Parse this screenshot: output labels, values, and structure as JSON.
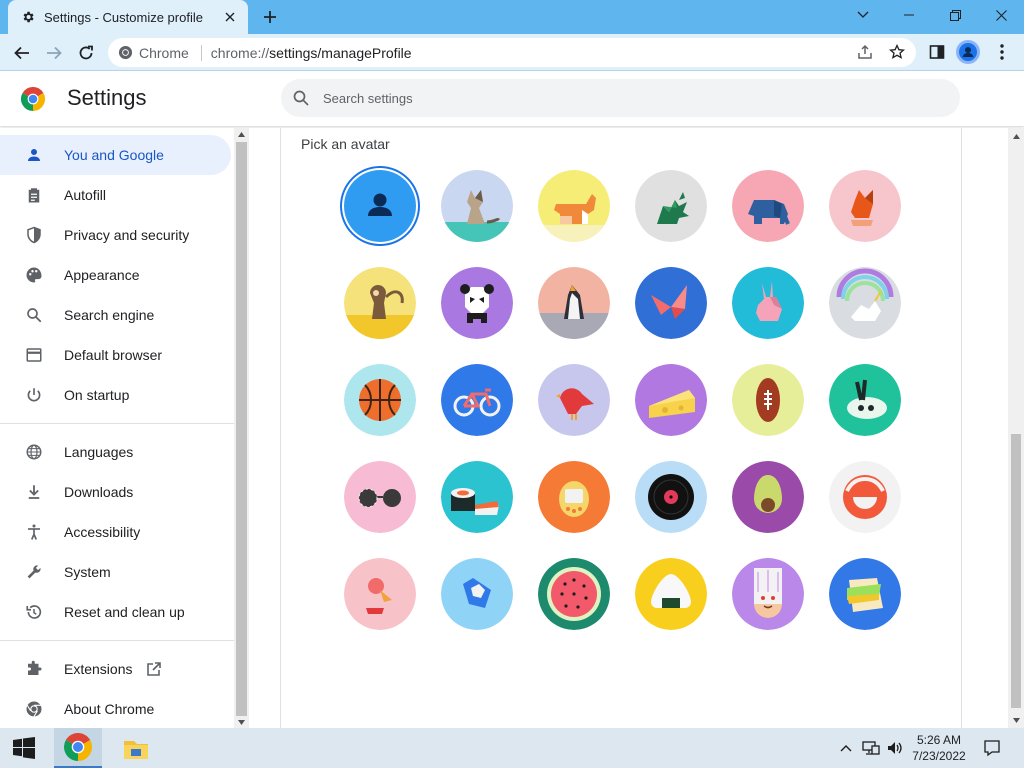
{
  "window": {
    "tab_title": "Settings - Customize profile",
    "url_chip": "Chrome",
    "url_scheme": "chrome://",
    "url_path": "settings/manageProfile"
  },
  "header": {
    "title": "Settings",
    "search_placeholder": "Search settings"
  },
  "sidebar": {
    "items": [
      {
        "label": "You and Google",
        "icon": "person-icon",
        "active": true
      },
      {
        "label": "Autofill",
        "icon": "clipboard-icon"
      },
      {
        "label": "Privacy and security",
        "icon": "shield-icon"
      },
      {
        "label": "Appearance",
        "icon": "palette-icon"
      },
      {
        "label": "Search engine",
        "icon": "search-icon"
      },
      {
        "label": "Default browser",
        "icon": "browser-icon"
      },
      {
        "label": "On startup",
        "icon": "power-icon"
      },
      {
        "label": "Languages",
        "icon": "globe-icon"
      },
      {
        "label": "Downloads",
        "icon": "download-icon"
      },
      {
        "label": "Accessibility",
        "icon": "accessibility-icon"
      },
      {
        "label": "System",
        "icon": "wrench-icon"
      },
      {
        "label": "Reset and clean up",
        "icon": "history-icon"
      },
      {
        "label": "Extensions",
        "icon": "puzzle-icon"
      },
      {
        "label": "About Chrome",
        "icon": "chrome-icon"
      }
    ]
  },
  "main": {
    "heading": "Pick an avatar",
    "avatars": [
      {
        "name": "generic-person",
        "bg": "#2f9cf2",
        "selected": true
      },
      {
        "name": "origami-cat",
        "bg": "#c9d7f0"
      },
      {
        "name": "origami-corgi",
        "bg": "#f5ed76"
      },
      {
        "name": "origami-dragon",
        "bg": "#e0e0e0"
      },
      {
        "name": "origami-elephant",
        "bg": "#f6a7b3"
      },
      {
        "name": "origami-fox",
        "bg": "#f7c6cc"
      },
      {
        "name": "origami-monkey",
        "bg": "#f6e27a"
      },
      {
        "name": "origami-panda",
        "bg": "#a978e0"
      },
      {
        "name": "origami-penguin",
        "bg": "#f3b3a3"
      },
      {
        "name": "origami-butterfly",
        "bg": "#2f6fd6"
      },
      {
        "name": "origami-rabbit",
        "bg": "#22bcd8"
      },
      {
        "name": "origami-unicorn",
        "bg": "#d9dde1"
      },
      {
        "name": "basketball",
        "bg": "#aee6ee"
      },
      {
        "name": "bike",
        "bg": "#2f79e8"
      },
      {
        "name": "red-bird",
        "bg": "#c7c7ee"
      },
      {
        "name": "cheese",
        "bg": "#b078e0"
      },
      {
        "name": "football",
        "bg": "#e7ee9a"
      },
      {
        "name": "sushi-plate",
        "bg": "#1fc29a"
      },
      {
        "name": "sunglasses",
        "bg": "#f7bcd4"
      },
      {
        "name": "sushi",
        "bg": "#2cc3d0"
      },
      {
        "name": "tamagotchi",
        "bg": "#f57a35"
      },
      {
        "name": "vinyl",
        "bg": "#b9dcf7"
      },
      {
        "name": "avocado",
        "bg": "#9a4aa8"
      },
      {
        "name": "cloud-smile",
        "bg": "#f2f2f2"
      },
      {
        "name": "ice-cream",
        "bg": "#f7c3c9"
      },
      {
        "name": "moon",
        "bg": "#8fd3f7"
      },
      {
        "name": "watermelon",
        "bg": "#1d8a6e"
      },
      {
        "name": "onigiri",
        "bg": "#f8cf1c"
      },
      {
        "name": "pizza",
        "bg": "#b988e8"
      },
      {
        "name": "sandwich",
        "bg": "#3278e6"
      }
    ]
  },
  "taskbar": {
    "time": "5:26 AM",
    "date": "7/23/2022"
  },
  "colors": {
    "accent": "#1a73e8",
    "titlebar": "#5fb6ee",
    "toolbar": "#dff0fb",
    "active_nav_bg": "#e8f0fe",
    "active_nav_text": "#1a56c4"
  }
}
